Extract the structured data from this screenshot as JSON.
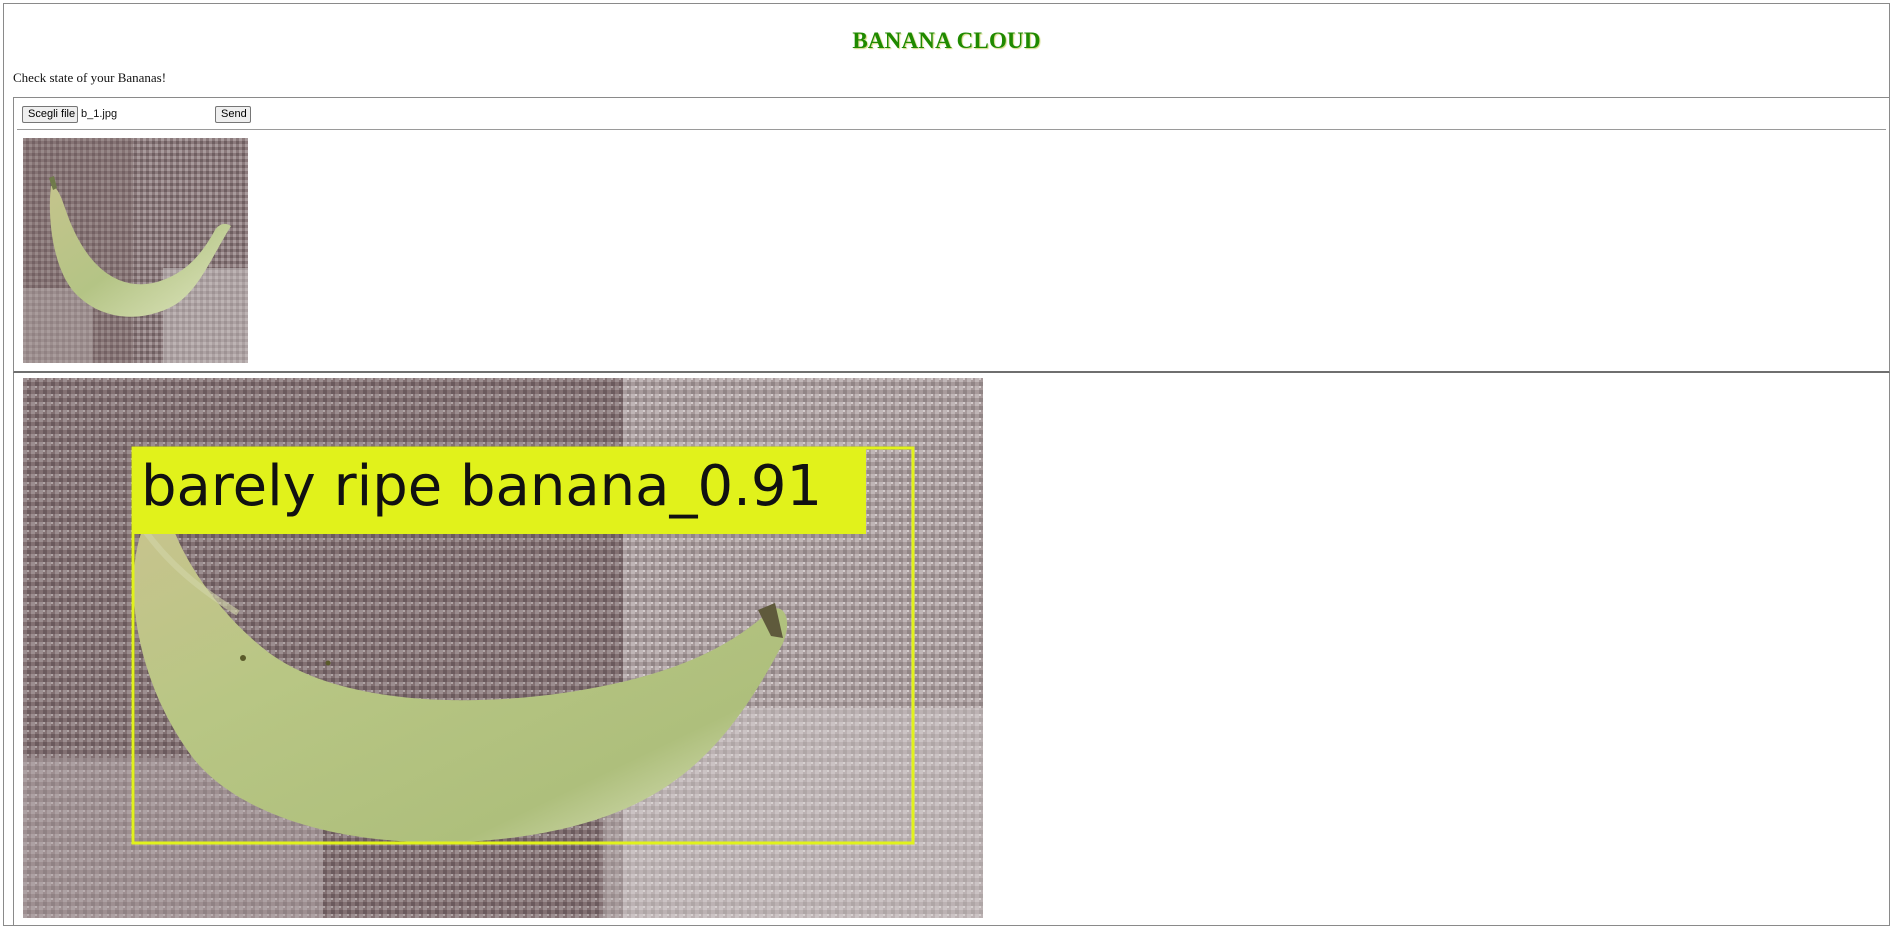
{
  "page": {
    "title": "BANANA CLOUD",
    "subtitle": "Check state of your Bananas!"
  },
  "upload": {
    "choose_file_label": "Scegli file",
    "file_name": "b_1.jpg",
    "send_label": "Send"
  },
  "result": {
    "detection_label": "barely ripe banana_0.91",
    "box_color": "#e1f21b"
  },
  "colors": {
    "title": "#1f8a00",
    "banana": "#b7c98a",
    "background_dark": "#7d6a6c",
    "background_light": "#cdc7c8"
  }
}
